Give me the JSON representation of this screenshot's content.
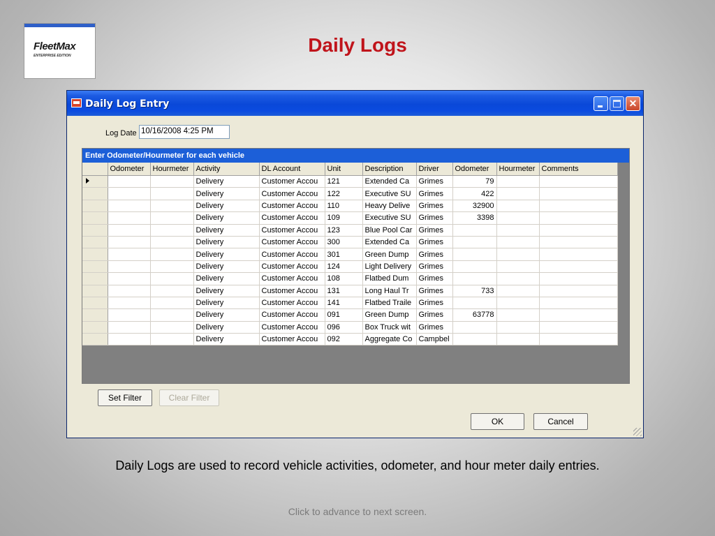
{
  "logo": {
    "brand": "FleetMax",
    "edition": "ENTERPRISE EDITION"
  },
  "slide": {
    "title": "Daily Logs",
    "caption": "Daily Logs are used to record vehicle activities, odometer, and hour meter daily entries.",
    "footer": "Click to advance to next screen."
  },
  "window": {
    "title": "Daily Log Entry"
  },
  "form": {
    "log_date_label": "Log Date",
    "log_date_value": "10/16/2008 4:25 PM"
  },
  "grid": {
    "caption": "Enter Odometer/Hourmeter for each vehicle",
    "columns": [
      "Odometer",
      "Hourmeter",
      "Activity",
      "DL Account",
      "Unit",
      "Description",
      "Driver",
      "Odometer",
      "Hourmeter",
      "Comments"
    ],
    "rows": [
      [
        "",
        "",
        "Delivery",
        "Customer Accou",
        "121",
        "Extended Ca",
        "Grimes",
        "79",
        "",
        ""
      ],
      [
        "",
        "",
        "Delivery",
        "Customer Accou",
        "122",
        "Executive SU",
        "Grimes",
        "422",
        "",
        ""
      ],
      [
        "",
        "",
        "Delivery",
        "Customer Accou",
        "110",
        "Heavy Delive",
        "Grimes",
        "32900",
        "",
        ""
      ],
      [
        "",
        "",
        "Delivery",
        "Customer Accou",
        "109",
        "Executive SU",
        "Grimes",
        "3398",
        "",
        ""
      ],
      [
        "",
        "",
        "Delivery",
        "Customer Accou",
        "123",
        "Blue Pool Car",
        "Grimes",
        "",
        "",
        ""
      ],
      [
        "",
        "",
        "Delivery",
        "Customer Accou",
        "300",
        "Extended Ca",
        "Grimes",
        "",
        "",
        ""
      ],
      [
        "",
        "",
        "Delivery",
        "Customer Accou",
        "301",
        "Green Dump",
        "Grimes",
        "",
        "",
        ""
      ],
      [
        "",
        "",
        "Delivery",
        "Customer Accou",
        "124",
        "Light Delivery",
        "Grimes",
        "",
        "",
        ""
      ],
      [
        "",
        "",
        "Delivery",
        "Customer Accou",
        "108",
        "Flatbed Dum",
        "Grimes",
        "",
        "",
        ""
      ],
      [
        "",
        "",
        "Delivery",
        "Customer Accou",
        "131",
        "Long Haul Tr",
        "Grimes",
        "733",
        "",
        ""
      ],
      [
        "",
        "",
        "Delivery",
        "Customer Accou",
        "141",
        "Flatbed Traile",
        "Grimes",
        "",
        "",
        ""
      ],
      [
        "",
        "",
        "Delivery",
        "Customer Accou",
        "091",
        "Green Dump",
        "Grimes",
        "63778",
        "",
        ""
      ],
      [
        "",
        "",
        "Delivery",
        "Customer Accou",
        "096",
        "Box Truck wit",
        "Grimes",
        "",
        "",
        ""
      ],
      [
        "",
        "",
        "Delivery",
        "Customer Accou",
        "092",
        "Aggregate Co",
        "Campbel",
        "",
        "",
        ""
      ]
    ]
  },
  "buttons": {
    "set_filter": "Set Filter",
    "clear_filter": "Clear Filter",
    "ok": "OK",
    "cancel": "Cancel"
  }
}
